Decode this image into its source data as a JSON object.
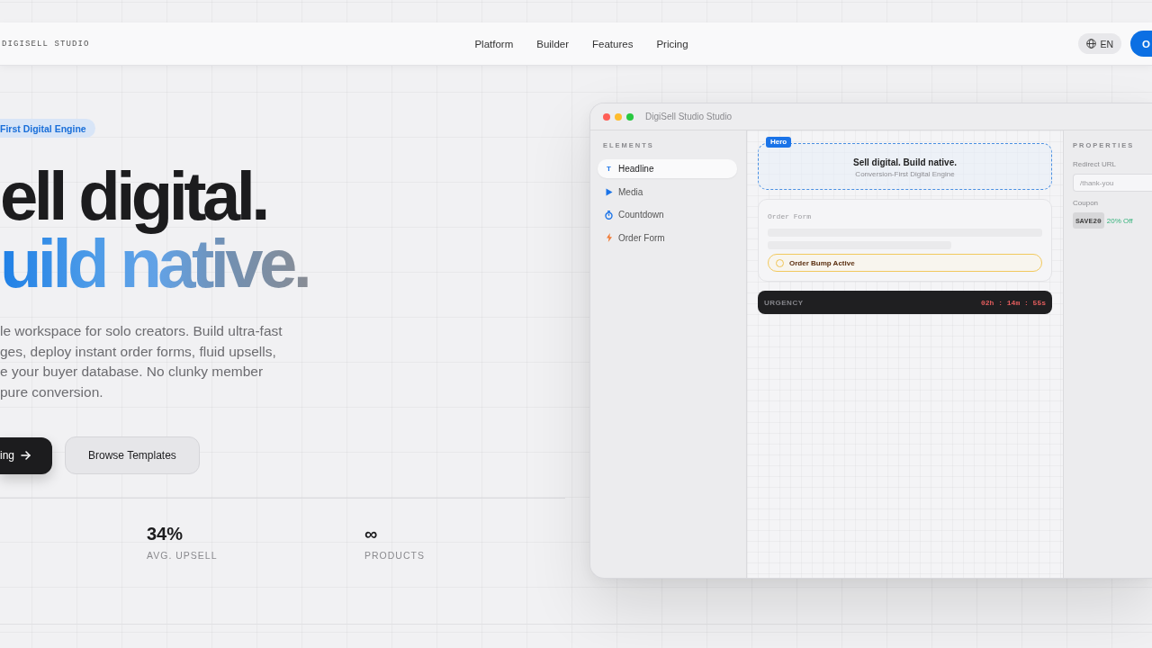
{
  "nav": {
    "logo": "DIGISELL STUDIO",
    "links": [
      {
        "label": "Platform"
      },
      {
        "label": "Builder"
      },
      {
        "label": "Features"
      },
      {
        "label": "Pricing"
      }
    ],
    "language": "EN",
    "cta": "O"
  },
  "hero": {
    "badge": "First Digital Engine",
    "headline": [
      {
        "text": "ell digital.",
        "kind": "plain"
      },
      {
        "text": "uild native.",
        "kind": "gradient"
      }
    ],
    "description": "le workspace for solo creators. Build ultra-fast\nges, deploy instant order forms, fluid upsells,\ne your buyer database. No clunky member\npure conversion.",
    "buttons": [
      {
        "label": "ing",
        "kind": "primary"
      },
      {
        "label": "Browse Templates",
        "kind": "secondary"
      }
    ],
    "stats": [
      {
        "value": "34%",
        "label": "AVG. UPSELL"
      },
      {
        "value": "∞",
        "label": "PRODUCTS"
      }
    ]
  },
  "studio": {
    "title": "DigiSell Studio Studio",
    "elements": {
      "heading": "ELEMENTS",
      "items": [
        {
          "kind": "text",
          "glyph": "T",
          "label": "Headline",
          "selected": true
        },
        {
          "kind": "media",
          "label": "Media",
          "selected": false
        },
        {
          "kind": "timer",
          "label": "Countdown",
          "selected": false
        },
        {
          "kind": "form",
          "label": "Order Form",
          "selected": false
        }
      ]
    },
    "canvas": {
      "hero_block": {
        "tag": "Hero",
        "title": "Sell digital. Build native.",
        "subtitle": "Conversion-First Digital Engine",
        "selected": true
      },
      "order_form": {
        "title": "Order Form",
        "bump": {
          "label": "Order Bump Active",
          "checked": false
        }
      },
      "urgency": {
        "label": "URGENCY",
        "timer": "02h : 14m : 55s"
      }
    },
    "properties": {
      "heading": "PROPERTIES",
      "redirect_label": "Redirect URL",
      "redirect_value": "/thank-you",
      "coupon_label": "Coupon",
      "coupon_code": "SAVE20",
      "coupon_discount": "20% Off"
    }
  }
}
